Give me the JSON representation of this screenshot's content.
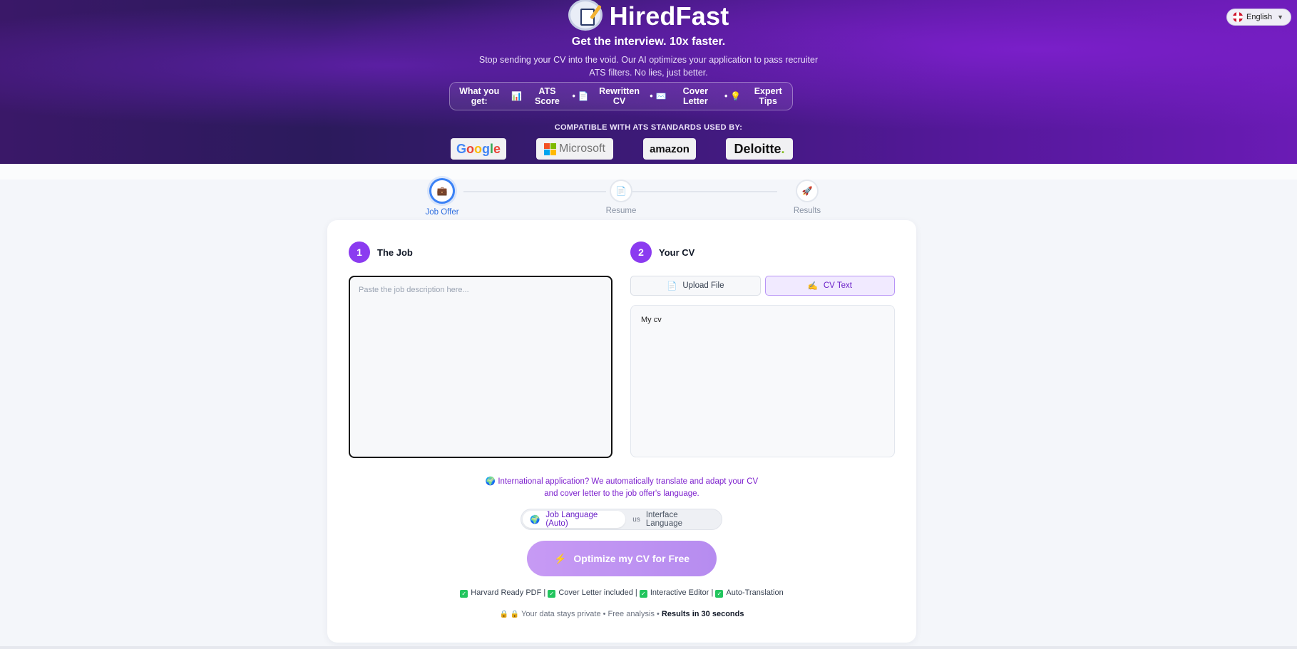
{
  "header": {
    "brand_name": "HiredFast",
    "tagline": "Get the interview. 10x faster.",
    "subtitle": "Stop sending your CV into the void. Our AI optimizes your application to pass recruiter ATS filters. No lies, just better.",
    "features_prefix": "What you get:",
    "features": [
      {
        "icon": "📊",
        "label": "ATS Score"
      },
      {
        "icon": "📄",
        "label": "Rewritten CV"
      },
      {
        "icon": "✉️",
        "label": "Cover Letter"
      },
      {
        "icon": "💡",
        "label": "Expert Tips"
      }
    ],
    "compat_label": "COMPATIBLE WITH ATS STANDARDS USED BY:",
    "logos": {
      "google": "Google",
      "microsoft": "Microsoft",
      "amazon": "amazon",
      "deloitte": "Deloitte",
      "deloitte_dot": "."
    },
    "language": "English"
  },
  "stepper": [
    {
      "label": "Job Offer",
      "icon": "💼",
      "active": true
    },
    {
      "label": "Resume",
      "icon": "📄",
      "active": false
    },
    {
      "label": "Results",
      "icon": "🚀",
      "active": false
    }
  ],
  "job": {
    "number": "1",
    "title": "The Job",
    "placeholder": "Paste the job description here...",
    "value": ""
  },
  "cv": {
    "number": "2",
    "title": "Your CV",
    "tabs": [
      {
        "icon": "📄",
        "label": "Upload File",
        "active": false
      },
      {
        "icon": "✍️",
        "label": "CV Text",
        "active": true
      }
    ],
    "value": "My cv"
  },
  "international": {
    "icon": "🌍",
    "text": "International application? We automatically translate and adapt your CV and cover letter to the job offer's language."
  },
  "language_toggle": [
    {
      "icon": "🌍",
      "label": "Job Language (Auto)",
      "active": true
    },
    {
      "icon": "us",
      "label": "Interface Language",
      "active": false
    }
  ],
  "cta": {
    "icon": "⚡",
    "label": "Optimize my CV for Free"
  },
  "perks": [
    "Harvard Ready PDF",
    "Cover Letter included",
    "Interactive Editor",
    "Auto-Translation"
  ],
  "privacy": {
    "icons": "🔒 🔒",
    "text": "Your data stays private • Free analysis •",
    "strong": "Results in 30 seconds"
  },
  "colors": {
    "accent": "#8b3bf0",
    "step_active": "#3b82f6",
    "check": "#22c55e"
  }
}
